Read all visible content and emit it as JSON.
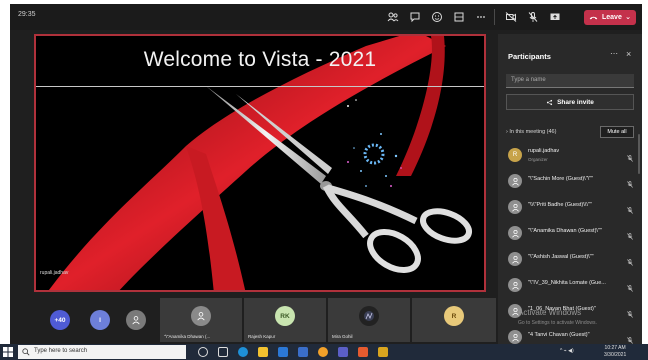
{
  "meeting": {
    "timer": "29:35",
    "leave_label": "Leave",
    "leave_color": "#c4314b"
  },
  "slide": {
    "title": "Welcome to Vista - 2021",
    "presenter": "rupali.jadhav",
    "accent_color": "#b0313b"
  },
  "participants_panel": {
    "title": "Participants",
    "search_placeholder": "Type a name",
    "share_invite_label": "Share invite",
    "in_meeting_label": "In this meeting (46)",
    "mute_all_label": "Mute all",
    "items": [
      {
        "name": "rupali.jadhav",
        "role": "Organizer",
        "initial": "R"
      },
      {
        "name": "\"\\\"Sachin More (Guest)\\\"\\\"\"",
        "role": ""
      },
      {
        "name": "\"\\\\\\\"Priti Badhe (Guest)\\\\\\\"\"",
        "role": ""
      },
      {
        "name": "\"\\\"Anamika Dhawan (Guest)\\\"\"",
        "role": ""
      },
      {
        "name": "\"\\\"Ashish Jaswal (Guest)\\\"\"",
        "role": ""
      },
      {
        "name": "\"\\\"IV_39_Nikhita Lomate (Gue...",
        "role": ""
      },
      {
        "name": "\"1_06_Nayan Bhat (Guest)\"",
        "role": ""
      },
      {
        "name": "\"4 Tanvi Chavan (Guest)\"",
        "role": ""
      }
    ]
  },
  "watermark": {
    "line1": "Activate Windows",
    "line2": "Go to Settings to activate Windows."
  },
  "gallery": {
    "more_count": "+40",
    "tiles": [
      {
        "label": "\"\\\"Anamika Dhawan (...",
        "initials": ""
      },
      {
        "label": "Rajesh Kapur",
        "initials": "RK"
      },
      {
        "label": "Mira Gohil",
        "initials": ""
      },
      {
        "label": "",
        "initials": "R"
      }
    ],
    "small_initial": "I"
  },
  "taskbar": {
    "search_placeholder": "Type here to search",
    "time": "10:27 AM",
    "date": "3/30/2021"
  }
}
